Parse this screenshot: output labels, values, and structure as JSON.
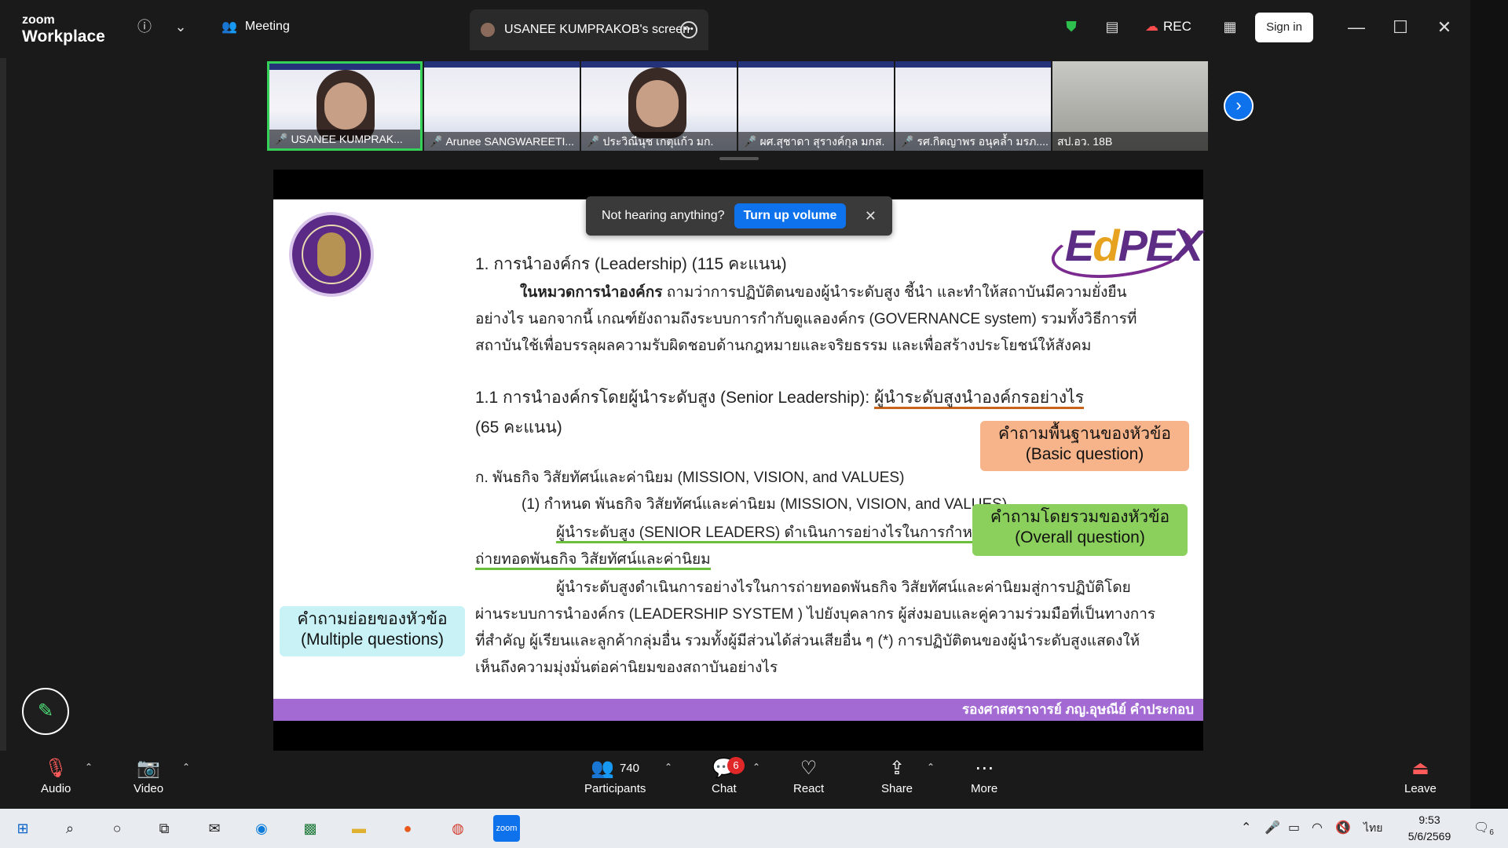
{
  "app": {
    "brand_top": "zoom",
    "brand_bottom": "Workplace"
  },
  "topbar": {
    "meeting_label": "Meeting",
    "screen_tab_label": "USANEE KUMPRAKOB's screen",
    "rec_label": "REC",
    "signin_label": "Sign in"
  },
  "gallery": {
    "tiles": [
      {
        "name": "USANEE KUMPRAK..."
      },
      {
        "name": "Arunee SANGWAREETI..."
      },
      {
        "name": "ประวิณีนุช เกตุแก้ว มก."
      },
      {
        "name": "ผศ.สุชาดา สุรางค์กุล มกส."
      },
      {
        "name": "รศ.กิตญาพร อนุคล้ำ มรภ...."
      },
      {
        "name": "สป.อว. 18B"
      }
    ]
  },
  "toast": {
    "message": "Not hearing anything?",
    "button": "Turn up volume",
    "close": "✕"
  },
  "slide": {
    "heading1": "1. การนำองค์กร (Leadership) (115 คะแนน)",
    "para1_line1_pre": "ในหมวดการนำองค์กร",
    "para1_line1_post": " ถามว่าการปฏิบัติตนของผู้นำระดับสูง ชี้นำ และทำให้สถาบันมีความยั่งยืน",
    "para1_line2": "อย่างไร นอกจากนี้ เกณฑ์ยังถามถึงระบบการกำกับดูแลองค์กร (GOVERNANCE system) รวมทั้งวิธีการที่",
    "para1_line3": "สถาบันใช้เพื่อบรรลุผลความรับผิดชอบด้านกฎหมายและจริยธรรม และเพื่อสร้างประโยชน์ให้สังคม",
    "heading2_pre": "1.1 การนำองค์กรโดยผู้นำระดับสูง (Senior Leadership): ",
    "heading2_underlined": "ผู้นำระดับสูงนำองค์กรอย่างไร",
    "heading2_line2": "(65 คะแนน)",
    "sub_a": "ก. พันธกิจ วิสัยทัศน์และค่านิยม (MISSION, VISION, and VALUES)",
    "item1_line1": "(1)   กำหนด พันธกิจ วิสัยทัศน์และค่านิยม (MISSION, VISION, and VALUES)",
    "item1_line2": "ผู้นำระดับสูง (SENIOR LEADERS) ดำเนินการอย่างไรในการกำหนดและ",
    "item1_line3": "ถ่ายทอดพันธกิจ วิสัยทัศน์และค่านิยม",
    "para2_line1": "ผู้นำระดับสูงดำเนินการอย่างไรในการถ่ายทอดพันธกิจ วิสัยทัศน์และค่านิยมสู่การปฏิบัติโดย",
    "para2_line2": "ผ่านระบบการนำองค์กร (LEADERSHIP SYSTEM ) ไปยังบุคลากร ผู้ส่งมอบและคู่ความร่วมมือที่เป็นทางการ",
    "para2_line3": "ที่สำคัญ ผู้เรียนและลูกค้ากลุ่มอื่น รวมทั้งผู้มีส่วนได้ส่วนเสียอื่น ๆ (*) การปฏิบัติตนของผู้นำระดับสูงแสดงให้",
    "para2_line4": "เห็นถึงความมุ่งมั่นต่อค่านิยมของสถาบันอย่างไร",
    "tag_basic_l1": "คำถามพื้นฐานของหัวข้อ",
    "tag_basic_l2": "(Basic question)",
    "tag_overall_l1": "คำถามโดยรวมของหัวข้อ",
    "tag_overall_l2": "(Overall question)",
    "tag_multi_l1": "คำถามย่อยของหัวข้อ",
    "tag_multi_l2": "(Multiple questions)",
    "footer": "รองศาสตราจารย์ ภญ.อุษณีย์ คำประกอบ",
    "logo_text_e": "E",
    "logo_text_d": "d",
    "logo_text_pex": "PEX"
  },
  "toolbar": {
    "audio": "Audio",
    "video": "Video",
    "participants": "Participants",
    "participants_count": "740",
    "chat": "Chat",
    "chat_badge": "6",
    "react": "React",
    "share": "Share",
    "more": "More",
    "leave": "Leave"
  },
  "taskbar": {
    "lang": "ไทย",
    "time": "9:53",
    "date": "5/6/2569",
    "notif": "6"
  },
  "colors": {
    "accent_blue": "#0e72ed",
    "active_green": "#34d058",
    "footer_purple": "#a36ad4"
  }
}
